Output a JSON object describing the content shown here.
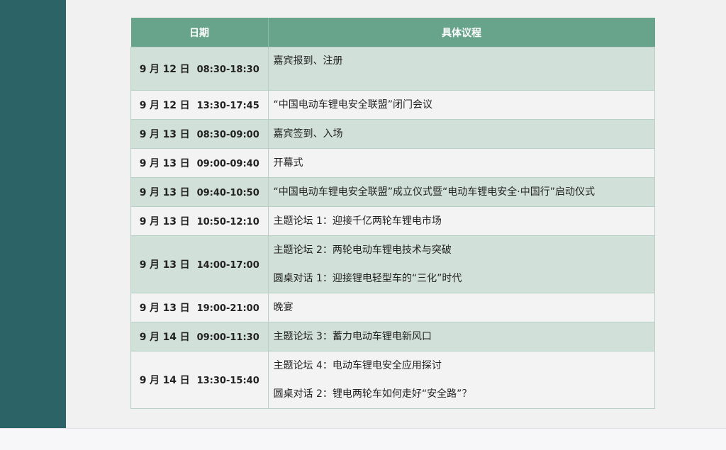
{
  "table": {
    "headers": {
      "date": "日期",
      "agenda": "具体议程"
    },
    "rows": [
      {
        "month": "9",
        "day": "12",
        "time": "08:30-18:30",
        "items": [
          "嘉宾报到、注册"
        ]
      },
      {
        "month": "9",
        "day": "12",
        "time": "13:30-17:45",
        "items": [
          "“中国电动车锂电安全联盟”闭门会议"
        ]
      },
      {
        "month": "9",
        "day": "13",
        "time": "08:30-09:00",
        "items": [
          "嘉宾签到、入场"
        ]
      },
      {
        "month": "9",
        "day": "13",
        "time": "09:00-09:40",
        "items": [
          "开幕式"
        ]
      },
      {
        "month": "9",
        "day": "13",
        "time": "09:40-10:50",
        "items": [
          "“中国电动车锂电安全联盟”成立仪式暨“电动车锂电安全·中国行”启动仪式"
        ]
      },
      {
        "month": "9",
        "day": "13",
        "time": "10:50-12:10",
        "items": [
          "主题论坛 1：迎接千亿两轮车锂电市场"
        ]
      },
      {
        "month": "9",
        "day": "13",
        "time": "14:00-17:00",
        "items": [
          "主题论坛 2：两轮电动车锂电技术与突破",
          "圆桌对话 1：迎接锂电轻型车的“三化”时代"
        ]
      },
      {
        "month": "9",
        "day": "13",
        "time": "19:00-21:00",
        "items": [
          "晚宴"
        ]
      },
      {
        "month": "9",
        "day": "14",
        "time": "09:00-11:30",
        "items": [
          "主题论坛 3：蓄力电动车锂电新风口"
        ]
      },
      {
        "month": "9",
        "day": "14",
        "time": "13:30-15:40",
        "items": [
          "主题论坛 4：电动车锂电安全应用探讨",
          "圆桌对话 2：锂电两轮车如何走好“安全路”？"
        ]
      }
    ],
    "labels": {
      "month_unit": "月",
      "day_unit": "日"
    }
  },
  "colors": {
    "sidebar": "#2b6367",
    "header": "#68a48c",
    "row_tint": "#d2e0da",
    "row_plain": "#f3f3f3"
  }
}
